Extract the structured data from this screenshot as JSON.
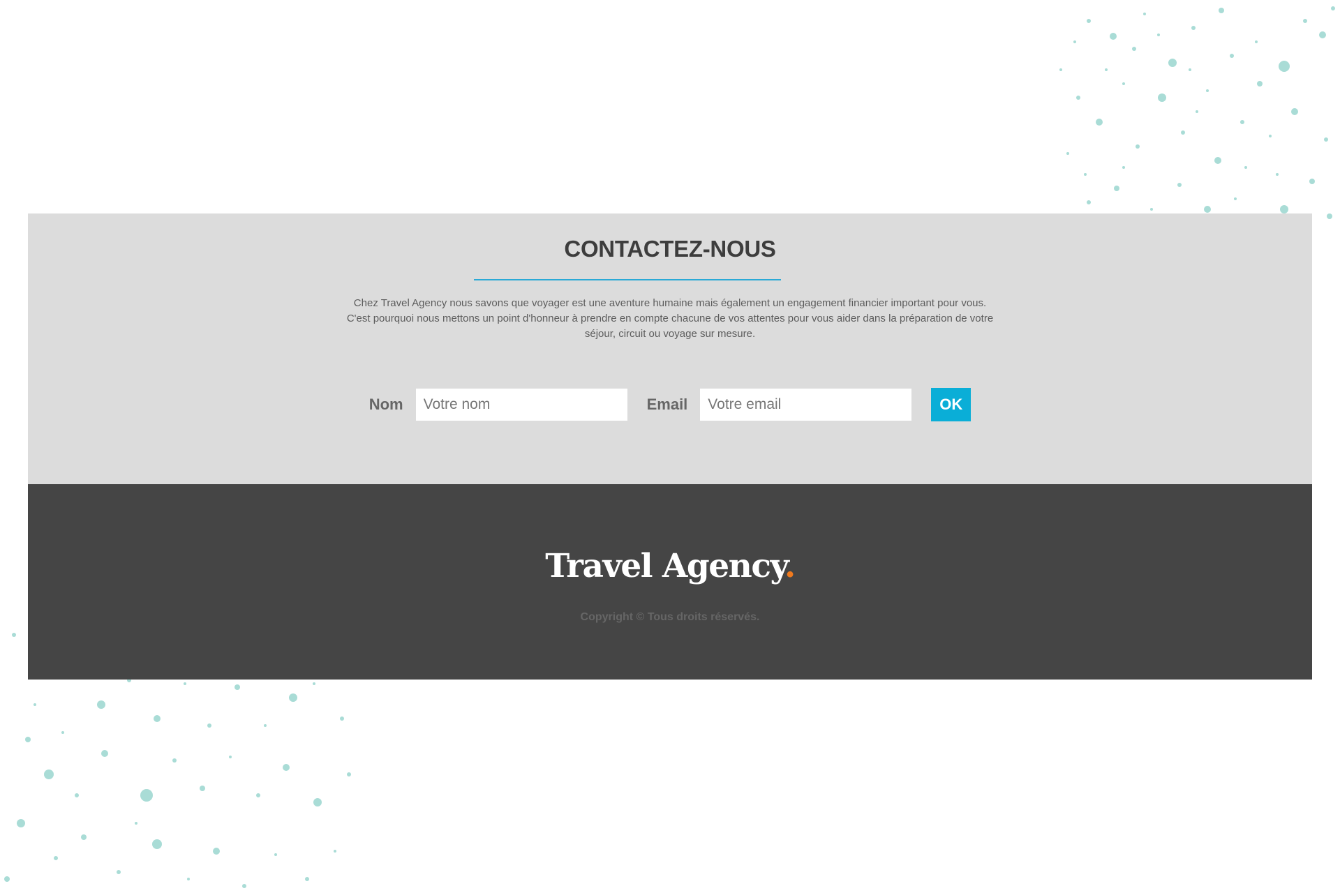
{
  "contact": {
    "title": "CONTACTEZ-NOUS",
    "description_lines": [
      "Chez Travel Agency nous savons que voyager est une aventure humaine mais également un engagement financier important pour vous.",
      "C'est pourquoi nous mettons un point d'honneur à prendre en compte chacune de vos attentes pour vous aider dans la préparation de votre",
      "séjour, circuit ou voyage sur mesure."
    ],
    "form": {
      "name_label": "Nom",
      "name_placeholder": "Votre nom",
      "name_value": "",
      "email_label": "Email",
      "email_placeholder": "Votre email",
      "email_value": "",
      "submit_label": "OK"
    }
  },
  "footer": {
    "logo_text": "Travel Agency",
    "logo_dot": ".",
    "copyright": "Copyright © Tous droits réservés."
  },
  "colors": {
    "accent": "#0aaed7",
    "underline": "#2aa9d6",
    "logo_dot": "#f07a1e",
    "contact_bg": "#dcdcdc",
    "footer_bg": "#454545",
    "splatter": "#a9dcd6"
  },
  "icons": [
    "paint-splatter-decoration"
  ]
}
